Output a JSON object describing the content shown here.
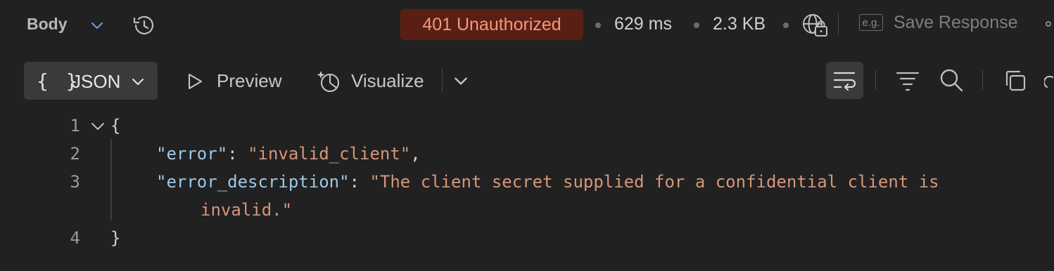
{
  "header": {
    "body_label": "Body",
    "status_text": "401 Unauthorized",
    "time": "629 ms",
    "size": "2.3 KB",
    "eg_label": "e.g.",
    "save_response_label": "Save Response",
    "colors": {
      "status_bg": "#5a1f14",
      "status_text": "#f2987c",
      "accent": "#6b9bd8"
    }
  },
  "toolbar": {
    "format_braces": "{ }",
    "format_label": "JSON",
    "preview_label": "Preview",
    "visualize_label": "Visualize"
  },
  "editor": {
    "lines": [
      {
        "number": "1",
        "text": "{"
      },
      {
        "number": "2",
        "key": "\"error\"",
        "value": "\"invalid_client\""
      },
      {
        "number": "3",
        "key": "\"error_description\"",
        "value": "\"The client secret supplied for a confidential client is",
        "value_cont": "invalid.\""
      },
      {
        "number": "4",
        "text": "}"
      }
    ],
    "colon": ":",
    "comma": ","
  },
  "icons": [
    "chevron-down-icon",
    "history-icon",
    "globe-lock-icon",
    "play-icon",
    "visualize-icon",
    "wrap-lines-icon",
    "filter-icon",
    "search-icon",
    "copy-icon"
  ]
}
